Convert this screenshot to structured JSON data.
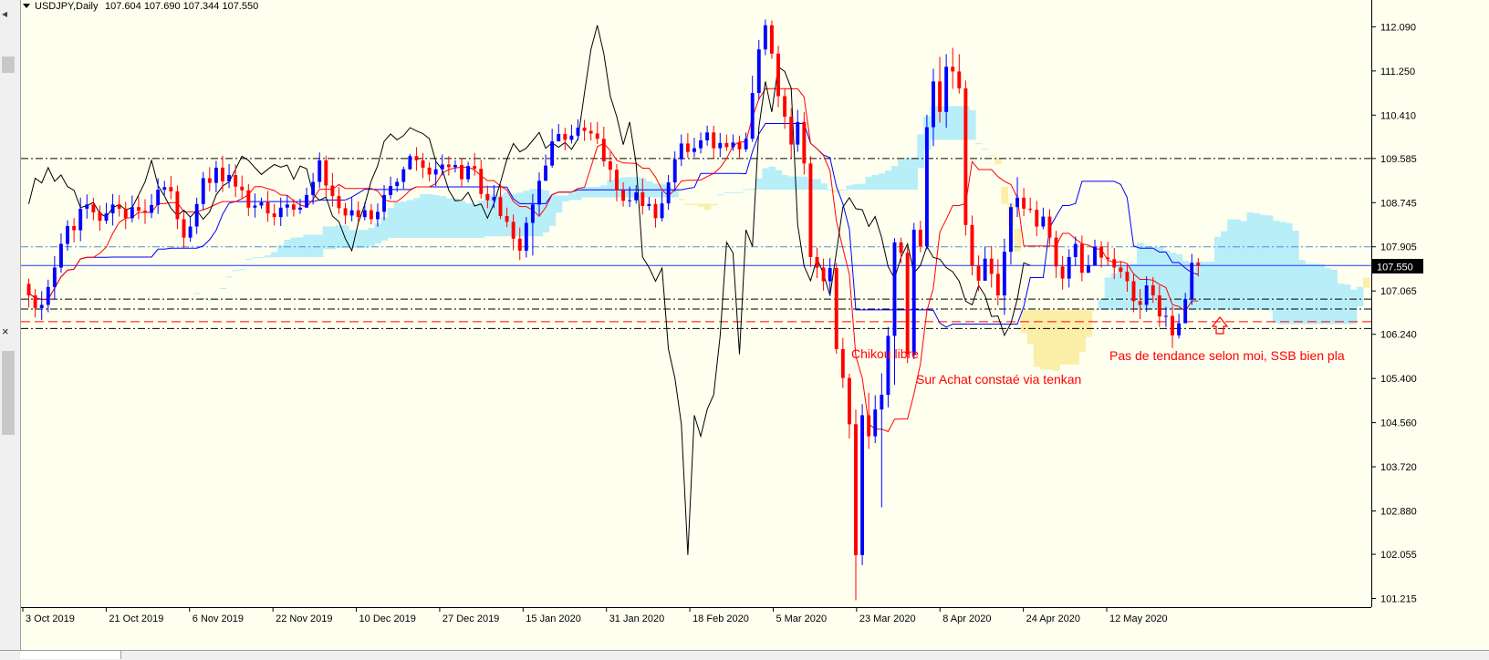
{
  "header": {
    "symbol_label": "USDJPY,Daily",
    "ohlc_label": "107.604 107.690 107.344 107.550"
  },
  "chart_data": {
    "type": "candlestick",
    "symbol": "USDJPY",
    "timeframe": "Daily",
    "y_axis": {
      "ticks": [
        "112.090",
        "111.250",
        "110.410",
        "109.585",
        "108.745",
        "107.905",
        "107.065",
        "106.240",
        "105.400",
        "104.560",
        "103.720",
        "102.880",
        "102.055",
        "101.215"
      ],
      "range": [
        101.05,
        112.6
      ]
    },
    "x_axis": {
      "ticks": [
        "3 Oct 2019",
        "21 Oct 2019",
        "6 Nov 2019",
        "22 Nov 2019",
        "10 Dec 2019",
        "27 Dec 2019",
        "15 Jan 2020",
        "31 Jan 2020",
        "18 Feb 2020",
        "5 Mar 2020",
        "23 Mar 2020",
        "8 Apr 2020",
        "24 Apr 2020",
        "12 May 2020"
      ]
    },
    "current_price": {
      "label": "107.550",
      "value": 107.55
    },
    "candles": [
      [
        107.2,
        106.98,
        107.3,
        106.75
      ],
      [
        106.98,
        106.74,
        107.1,
        106.56
      ],
      [
        106.74,
        106.8,
        107.06,
        106.51
      ],
      [
        106.8,
        107.14,
        107.28,
        106.66
      ],
      [
        107.14,
        107.51,
        107.73,
        106.9
      ],
      [
        107.51,
        107.96,
        108.16,
        107.41
      ],
      [
        107.96,
        108.3,
        108.41,
        107.83
      ],
      [
        108.3,
        108.22,
        108.45,
        107.99
      ],
      [
        108.22,
        108.63,
        108.84,
        108.01
      ],
      [
        108.63,
        108.71,
        108.9,
        108.44
      ],
      [
        108.71,
        108.56,
        108.84,
        108.41
      ],
      [
        108.56,
        108.4,
        108.69,
        108.21
      ],
      [
        108.4,
        108.54,
        108.74,
        108.34
      ],
      [
        108.54,
        108.71,
        108.91,
        108.31
      ],
      [
        108.71,
        108.63,
        108.89,
        108.48
      ],
      [
        108.63,
        108.45,
        108.76,
        108.24
      ],
      [
        108.45,
        108.66,
        108.88,
        108.37
      ],
      [
        108.66,
        108.59,
        108.86,
        108.43
      ],
      [
        108.59,
        108.55,
        108.81,
        108.34
      ],
      [
        108.55,
        108.7,
        108.91,
        108.45
      ],
      [
        108.7,
        108.99,
        109.21,
        108.53
      ],
      [
        108.99,
        109.04,
        109.16,
        108.89
      ],
      [
        109.04,
        108.96,
        109.25,
        108.81
      ],
      [
        108.96,
        108.43,
        109.07,
        108.24
      ],
      [
        108.43,
        108.08,
        108.58,
        107.89
      ],
      [
        108.08,
        108.29,
        108.49,
        108.0
      ],
      [
        108.29,
        108.72,
        108.84,
        108.15
      ],
      [
        108.72,
        109.21,
        109.33,
        108.6
      ],
      [
        109.21,
        109.12,
        109.42,
        108.96
      ],
      [
        109.12,
        109.41,
        109.54,
        108.94
      ],
      [
        109.41,
        109.15,
        109.64,
        108.95
      ],
      [
        109.15,
        109.27,
        109.48,
        109.02
      ],
      [
        109.27,
        109.05,
        109.47,
        108.85
      ],
      [
        109.05,
        108.98,
        109.26,
        108.83
      ],
      [
        108.98,
        108.65,
        109.1,
        108.49
      ],
      [
        108.65,
        108.69,
        108.92,
        108.46
      ],
      [
        108.69,
        108.75,
        108.84,
        108.63
      ],
      [
        108.75,
        108.54,
        108.97,
        108.38
      ],
      [
        108.54,
        108.47,
        108.72,
        108.31
      ],
      [
        108.47,
        108.65,
        108.84,
        108.3
      ],
      [
        108.65,
        108.71,
        108.89,
        108.48
      ],
      [
        108.71,
        108.61,
        108.81,
        108.48
      ],
      [
        108.61,
        108.65,
        108.82,
        108.53
      ],
      [
        108.65,
        108.89,
        109.03,
        108.65
      ],
      [
        108.89,
        109.14,
        109.31,
        108.71
      ],
      [
        109.14,
        109.55,
        109.7,
        109.02
      ],
      [
        109.55,
        109.07,
        109.64,
        108.86
      ],
      [
        109.07,
        108.87,
        109.31,
        108.67
      ],
      [
        108.87,
        108.64,
        109.04,
        108.53
      ],
      [
        108.64,
        108.5,
        108.74,
        108.33
      ],
      [
        108.5,
        108.6,
        108.84,
        108.39
      ],
      [
        108.6,
        108.47,
        108.77,
        108.36
      ],
      [
        108.47,
        108.6,
        108.75,
        108.41
      ],
      [
        108.6,
        108.43,
        108.72,
        108.33
      ],
      [
        108.43,
        108.57,
        108.73,
        108.29
      ],
      [
        108.57,
        108.89,
        109.08,
        108.41
      ],
      [
        108.89,
        109.06,
        109.24,
        108.81
      ],
      [
        109.06,
        109.14,
        109.21,
        108.95
      ],
      [
        109.14,
        109.38,
        109.43,
        109.01
      ],
      [
        109.38,
        109.63,
        109.67,
        109.37
      ],
      [
        109.63,
        109.55,
        109.8,
        109.35
      ],
      [
        109.55,
        109.41,
        109.69,
        109.21
      ],
      [
        109.41,
        109.28,
        109.51,
        109.15
      ],
      [
        109.28,
        109.38,
        109.52,
        109.06
      ],
      [
        109.38,
        109.47,
        109.66,
        109.26
      ],
      [
        109.47,
        109.42,
        109.63,
        109.26
      ],
      [
        109.42,
        109.46,
        109.55,
        109.32
      ],
      [
        109.46,
        109.19,
        109.59,
        109.04
      ],
      [
        109.19,
        109.44,
        109.52,
        109.13
      ],
      [
        109.44,
        109.39,
        109.69,
        109.26
      ],
      [
        109.39,
        108.91,
        109.56,
        108.82
      ],
      [
        108.91,
        108.79,
        109.07,
        108.64
      ],
      [
        108.79,
        108.85,
        109.08,
        108.64
      ],
      [
        108.85,
        108.49,
        109.09,
        108.43
      ],
      [
        108.49,
        108.38,
        108.65,
        108.28
      ],
      [
        108.38,
        108.06,
        108.52,
        107.84
      ],
      [
        108.06,
        107.83,
        108.27,
        107.65
      ],
      [
        107.83,
        108.36,
        108.47,
        107.7
      ],
      [
        108.36,
        108.71,
        108.91,
        107.74
      ],
      [
        108.71,
        109.16,
        109.32,
        108.51
      ],
      [
        109.16,
        109.45,
        109.66,
        109.29
      ],
      [
        109.45,
        109.91,
        110.15,
        109.41
      ],
      [
        109.91,
        110.05,
        110.24,
        109.92
      ],
      [
        110.05,
        109.94,
        110.17,
        109.74
      ],
      [
        109.94,
        110.02,
        110.23,
        109.87
      ],
      [
        110.02,
        110.17,
        110.33,
        109.93
      ],
      [
        110.17,
        110.11,
        110.32,
        109.92
      ],
      [
        110.11,
        110.06,
        110.27,
        109.93
      ],
      [
        110.06,
        109.96,
        110.28,
        109.86
      ],
      [
        109.96,
        109.53,
        110.19,
        109.43
      ],
      [
        109.53,
        109.37,
        109.71,
        109.14
      ],
      [
        109.37,
        108.98,
        109.48,
        108.77
      ],
      [
        108.98,
        108.78,
        109.13,
        108.67
      ],
      [
        108.78,
        108.79,
        109.05,
        108.66
      ],
      [
        108.79,
        108.94,
        109.08,
        108.73
      ],
      [
        108.94,
        108.68,
        109.21,
        108.52
      ],
      [
        108.68,
        108.72,
        108.85,
        108.6
      ],
      [
        108.72,
        108.45,
        108.82,
        108.27
      ],
      [
        108.45,
        108.73,
        108.96,
        108.39
      ],
      [
        108.73,
        109.13,
        109.27,
        108.61
      ],
      [
        109.13,
        109.57,
        109.72,
        108.96
      ],
      [
        109.57,
        109.87,
        110.04,
        109.44
      ],
      [
        109.87,
        109.71,
        110.07,
        109.6
      ],
      [
        109.71,
        109.78,
        109.98,
        109.61
      ],
      [
        109.78,
        109.93,
        110.08,
        109.68
      ],
      [
        109.93,
        110.08,
        110.21,
        109.83
      ],
      [
        110.08,
        109.78,
        110.21,
        109.59
      ],
      [
        109.78,
        109.88,
        110.07,
        109.61
      ],
      [
        109.88,
        109.8,
        110.04,
        109.73
      ],
      [
        109.8,
        109.89,
        110.04,
        109.73
      ],
      [
        109.89,
        109.76,
        110.02,
        109.6
      ],
      [
        109.76,
        109.96,
        110.08,
        109.71
      ],
      [
        109.96,
        110.83,
        111.16,
        109.9
      ],
      [
        110.83,
        111.66,
        111.84,
        110.71
      ],
      [
        111.66,
        112.12,
        112.23,
        111.55
      ],
      [
        112.12,
        111.58,
        112.21,
        111.48
      ],
      [
        111.58,
        110.77,
        111.73,
        110.56
      ],
      [
        110.77,
        110.38,
        110.91,
        110.15
      ],
      [
        110.38,
        109.85,
        110.54,
        109.59
      ],
      [
        109.85,
        110.28,
        110.51,
        109.71
      ],
      [
        110.28,
        109.49,
        110.47,
        109.28
      ],
      [
        109.49,
        107.71,
        109.63,
        107.52
      ],
      [
        107.71,
        107.51,
        107.89,
        107.31
      ],
      [
        107.51,
        107.25,
        107.68,
        107.07
      ],
      [
        107.25,
        107.5,
        107.69,
        106.97
      ],
      [
        107.5,
        105.96,
        107.6,
        105.87
      ],
      [
        105.96,
        105.41,
        106.17,
        105.22
      ],
      [
        105.41,
        104.53,
        105.49,
        104.26
      ],
      [
        104.53,
        102.04,
        104.81,
        101.18
      ],
      [
        102.04,
        104.7,
        104.91,
        101.85
      ],
      [
        104.7,
        104.3,
        105.13,
        104.06
      ],
      [
        104.3,
        104.81,
        105.08,
        104.17
      ],
      [
        104.81,
        105.09,
        105.5,
        102.95
      ],
      [
        105.09,
        106.21,
        106.38,
        104.85
      ],
      [
        106.21,
        107.99,
        108.07,
        105.28
      ],
      [
        107.99,
        107.79,
        108.08,
        107.59
      ],
      [
        107.79,
        105.86,
        107.92,
        105.69
      ],
      [
        105.86,
        108.23,
        108.36,
        105.77
      ],
      [
        108.23,
        107.91,
        108.4,
        107.8
      ],
      [
        107.91,
        110.18,
        110.42,
        107.86
      ],
      [
        110.18,
        111.05,
        111.29,
        109.82
      ],
      [
        111.05,
        110.47,
        111.52,
        110.27
      ],
      [
        110.47,
        111.33,
        111.57,
        110.17
      ],
      [
        111.33,
        111.24,
        111.69,
        110.91
      ],
      [
        111.24,
        110.92,
        111.57,
        110.82
      ],
      [
        110.92,
        108.32,
        111.07,
        108.12
      ],
      [
        108.32,
        107.54,
        108.5,
        107.36
      ],
      [
        107.54,
        107.26,
        107.74,
        107.06
      ],
      [
        107.26,
        107.68,
        107.9,
        107.48
      ],
      [
        107.68,
        107.39,
        107.92,
        107.13
      ],
      [
        107.39,
        106.98,
        107.67,
        106.79
      ],
      [
        106.98,
        107.81,
        108.06,
        106.61
      ],
      [
        107.81,
        108.66,
        108.73,
        107.57
      ],
      [
        108.66,
        108.84,
        109.23,
        108.47
      ],
      [
        108.84,
        108.63,
        109.02,
        108.49
      ],
      [
        108.63,
        108.61,
        108.84,
        108.55
      ],
      [
        108.61,
        108.29,
        108.78,
        108.11
      ],
      [
        108.29,
        108.48,
        108.65,
        108.24
      ],
      [
        108.48,
        108.08,
        108.62,
        107.94
      ],
      [
        108.08,
        107.53,
        108.21,
        107.31
      ],
      [
        107.53,
        107.3,
        107.73,
        107.09
      ],
      [
        107.3,
        107.71,
        107.86,
        107.13
      ],
      [
        107.71,
        107.96,
        108.1,
        107.54
      ],
      [
        107.96,
        107.41,
        108.12,
        107.25
      ],
      [
        107.41,
        107.55,
        107.75,
        107.42
      ],
      [
        107.55,
        107.91,
        108.04,
        107.74
      ],
      [
        107.91,
        107.7,
        108.01,
        107.51
      ],
      [
        107.7,
        107.67,
        108.0,
        107.55
      ],
      [
        107.67,
        107.51,
        107.88,
        107.29
      ],
      [
        107.51,
        107.43,
        107.63,
        107.31
      ],
      [
        107.43,
        107.25,
        107.56,
        107.05
      ],
      [
        107.25,
        106.87,
        107.38,
        106.66
      ],
      [
        106.87,
        106.8,
        107.1,
        106.53
      ],
      [
        106.8,
        107.17,
        107.34,
        106.67
      ],
      [
        107.17,
        106.98,
        107.33,
        106.84
      ],
      [
        106.98,
        106.58,
        107.17,
        106.38
      ],
      [
        106.58,
        106.59,
        106.76,
        106.38
      ],
      [
        106.59,
        106.22,
        106.77,
        105.98
      ],
      [
        106.22,
        106.45,
        106.63,
        106.16
      ],
      [
        106.45,
        106.91,
        107.03,
        106.49
      ],
      [
        106.91,
        107.6,
        107.77,
        106.8
      ],
      [
        107.6,
        107.55,
        107.69,
        107.34
      ]
    ],
    "overlays": {
      "tenkan_sen": {
        "color": "#ff0000"
      },
      "kijun_sen": {
        "color": "#0000ff"
      },
      "chikou_span": {
        "color": "#000000"
      },
      "kumo_bullish": {
        "color": "#b8eef8"
      },
      "kumo_bearish": {
        "color": "#fbefa8"
      }
    },
    "horizontal_lines": [
      {
        "value": 109.585,
        "style": "dash-dot",
        "color": "#000000"
      },
      {
        "value": 107.905,
        "style": "dash-dot",
        "color": "#4a90d9"
      },
      {
        "value": 107.55,
        "style": "solid",
        "color": "#1a3cff"
      },
      {
        "value": 106.91,
        "style": "dash-dot",
        "color": "#000000"
      },
      {
        "value": 106.72,
        "style": "dash-dot",
        "color": "#000000"
      },
      {
        "value": 106.48,
        "style": "dashed",
        "color": "#ff0000"
      },
      {
        "value": 106.35,
        "style": "dash-dot",
        "color": "#000000"
      }
    ],
    "annotations": [
      {
        "text": "Chikou libre",
        "color": "#ff0000"
      },
      {
        "text": "Sur Achat constaé via tenkan",
        "color": "#ff0000"
      },
      {
        "text": "Pas de tendance selon moi, SSB bien pla",
        "color": "#ff0000"
      }
    ],
    "grid": false
  }
}
